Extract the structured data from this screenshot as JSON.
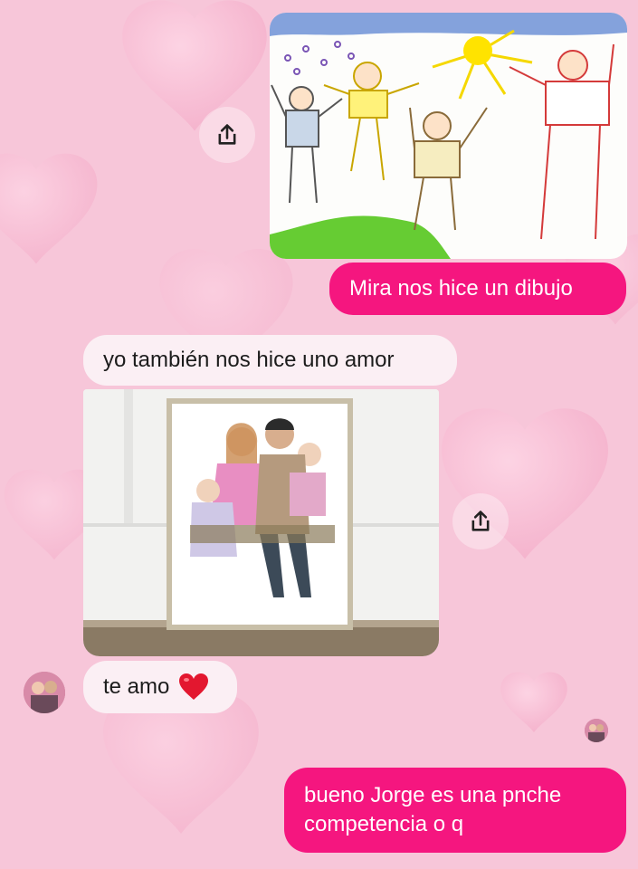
{
  "messages": {
    "sent_1": "Mira nos hice un dibujo",
    "recv_1": "yo también nos hice uno amor",
    "recv_2_text": "te amo",
    "recv_2_emoji": "❤️",
    "sent_2_line1": "bueno Jorge es una pnche",
    "sent_2_line2": "competencia o q"
  },
  "icons": {
    "share": "share-icon",
    "heart": "red-heart-emoji"
  },
  "colors": {
    "background": "#f7c6d9",
    "sent_bubble": "#f5167f",
    "received_bubble": "#fbeff4"
  }
}
